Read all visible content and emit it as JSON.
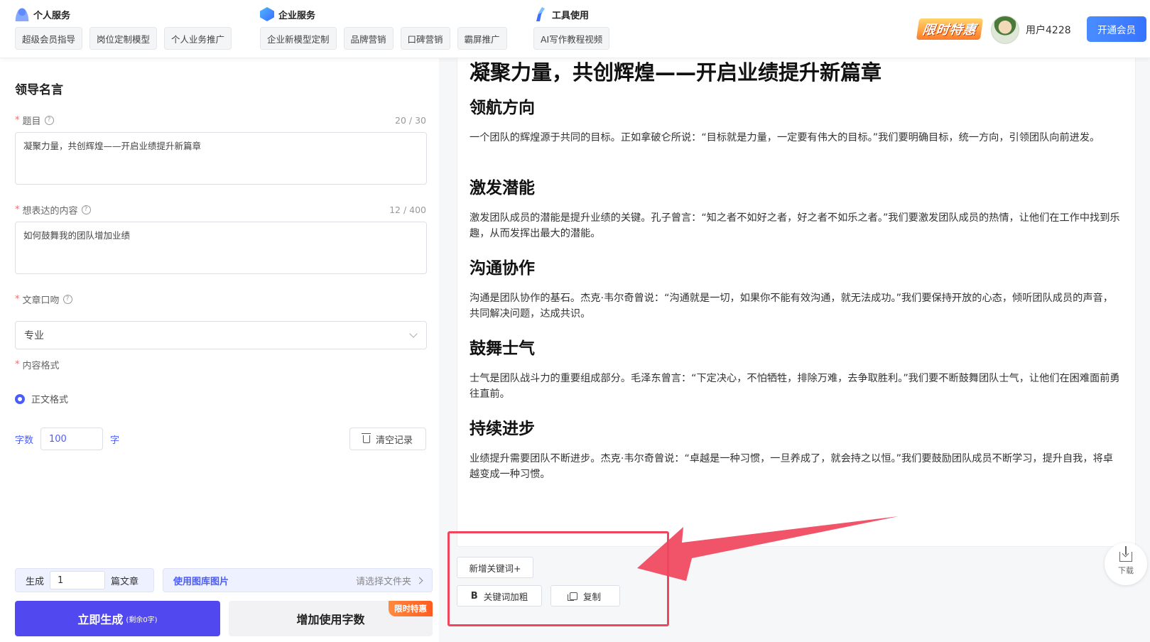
{
  "header": {
    "groups": [
      {
        "title": "个人服务",
        "items": [
          "超级会员指导",
          "岗位定制模型",
          "个人业务推广"
        ]
      },
      {
        "title": "企业服务",
        "items": [
          "企业新模型定制",
          "品牌营销",
          "口碑营销",
          "霸屏推广"
        ]
      },
      {
        "title": "工具使用",
        "items": [
          "AI写作教程视频"
        ]
      }
    ],
    "promo_label": "限时特惠",
    "username": "用户4228",
    "vip_label": "开通会员"
  },
  "form": {
    "panel_title": "领导名言",
    "topic": {
      "label": "题目",
      "counter": "20 / 30",
      "value": "凝聚力量，共创辉煌——开启业绩提升新篇章"
    },
    "content": {
      "label": "想表达的内容",
      "counter": "12 / 400",
      "value": "如何鼓舞我的团队增加业绩"
    },
    "tone": {
      "label": "文章口吻",
      "value": "专业"
    },
    "format": {
      "label": "内容格式",
      "option": "正文格式"
    },
    "words": {
      "label": "字数",
      "value": "100",
      "unit": "字"
    },
    "clear_label": "清空记录",
    "generate": {
      "prefix": "生成",
      "value": "1",
      "suffix": "篇文章"
    },
    "library": {
      "label": "使用图库图片",
      "hint": "请选择文件夹"
    },
    "generate_btn": {
      "label": "立即生成",
      "note": "(剩余0字)"
    },
    "more_btn": {
      "label": "增加使用字数",
      "badge": "限时特惠"
    }
  },
  "article": {
    "title": "凝聚力量，共创辉煌——开启业绩提升新篇章",
    "sections": [
      {
        "heading": "领航方向",
        "body": "一个团队的辉煌源于共同的目标。正如拿破仑所说：“目标就是力量，一定要有伟大的目标。”我们要明确目标，统一方向，引领团队向前进发。"
      },
      {
        "heading": "激发潜能",
        "body": "激发团队成员的潜能是提升业绩的关键。孔子曾言：“知之者不如好之者，好之者不如乐之者。”我们要激发团队成员的热情，让他们在工作中找到乐趣，从而发挥出最大的潜能。"
      },
      {
        "heading": "沟通协作",
        "body": "沟通是团队协作的基石。杰克·韦尔奇曾说：“沟通就是一切，如果你不能有效沟通，就无法成功。”我们要保持开放的心态，倾听团队成员的声音，共同解决问题，达成共识。"
      },
      {
        "heading": "鼓舞士气",
        "body": "士气是团队战斗力的重要组成部分。毛泽东曾言：“下定决心，不怕牺牲，排除万难，去争取胜利。”我们要不断鼓舞团队士气，让他们在困难面前勇往直前。"
      },
      {
        "heading": "持续进步",
        "body": "业绩提升需要团队不断进步。杰克·韦尔奇曾说：“卓越是一种习惯，一旦养成了，就会持之以恒。”我们要鼓励团队成员不断学习，提升自我，将卓越变成一种习惯。"
      }
    ]
  },
  "toolbar": {
    "add_keyword": "新增关键词+",
    "bold_keyword": "关键词加粗",
    "copy": "复制",
    "download": "下载"
  },
  "colors": {
    "accent": "#5148f0",
    "vip": "#3773ff",
    "annotation": "#f0455c"
  }
}
